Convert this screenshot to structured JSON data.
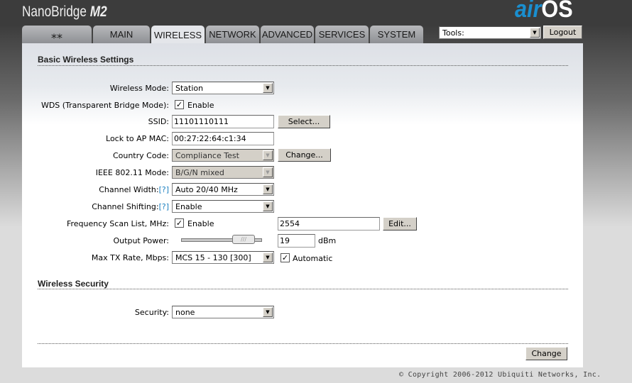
{
  "header": {
    "brand": "NanoBridge",
    "brand_model": "M2",
    "logo_air": "air",
    "logo_os": "OS"
  },
  "tabs": [
    {
      "label": "",
      "icon": "ubiquiti-logo-icon"
    },
    {
      "label": "MAIN"
    },
    {
      "label": "WIRELESS",
      "active": true
    },
    {
      "label": "NETWORK"
    },
    {
      "label": "ADVANCED"
    },
    {
      "label": "SERVICES"
    },
    {
      "label": "SYSTEM"
    }
  ],
  "tools": {
    "value": "Tools:"
  },
  "logout_label": "Logout",
  "basic": {
    "title": "Basic Wireless Settings",
    "wireless_mode": {
      "label": "Wireless Mode:",
      "value": "Station"
    },
    "wds": {
      "label": "WDS (Transparent Bridge Mode):",
      "checked": true,
      "option": "Enable"
    },
    "ssid": {
      "label": "SSID:",
      "value": "11101110111",
      "button": "Select..."
    },
    "ap_mac": {
      "label": "Lock to AP MAC:",
      "value": "00:27:22:64:c1:34"
    },
    "country": {
      "label": "Country Code:",
      "value": "Compliance Test",
      "button": "Change..."
    },
    "ieee_mode": {
      "label": "IEEE 802.11 Mode:",
      "value": "B/G/N mixed"
    },
    "channel_width": {
      "label": "Channel Width:",
      "help": "[?]",
      "value": "Auto 20/40 MHz"
    },
    "channel_shifting": {
      "label": "Channel Shifting:",
      "help": "[?]",
      "value": "Enable"
    },
    "freq_scan": {
      "label": "Frequency Scan List, MHz:",
      "checked": true,
      "option": "Enable",
      "value": "2554",
      "button": "Edit..."
    },
    "output_power": {
      "label": "Output Power:",
      "value": "19",
      "unit": "dBm",
      "slider_fraction": 0.72
    },
    "max_tx": {
      "label": "Max TX Rate, Mbps:",
      "value": "MCS 15 - 130 [300]",
      "auto_checked": true,
      "auto_label": "Automatic"
    }
  },
  "security": {
    "title": "Wireless Security",
    "label": "Security:",
    "value": "none"
  },
  "change_label": "Change",
  "copyright": "© Copyright 2006-2012 Ubiquiti Networks, Inc."
}
